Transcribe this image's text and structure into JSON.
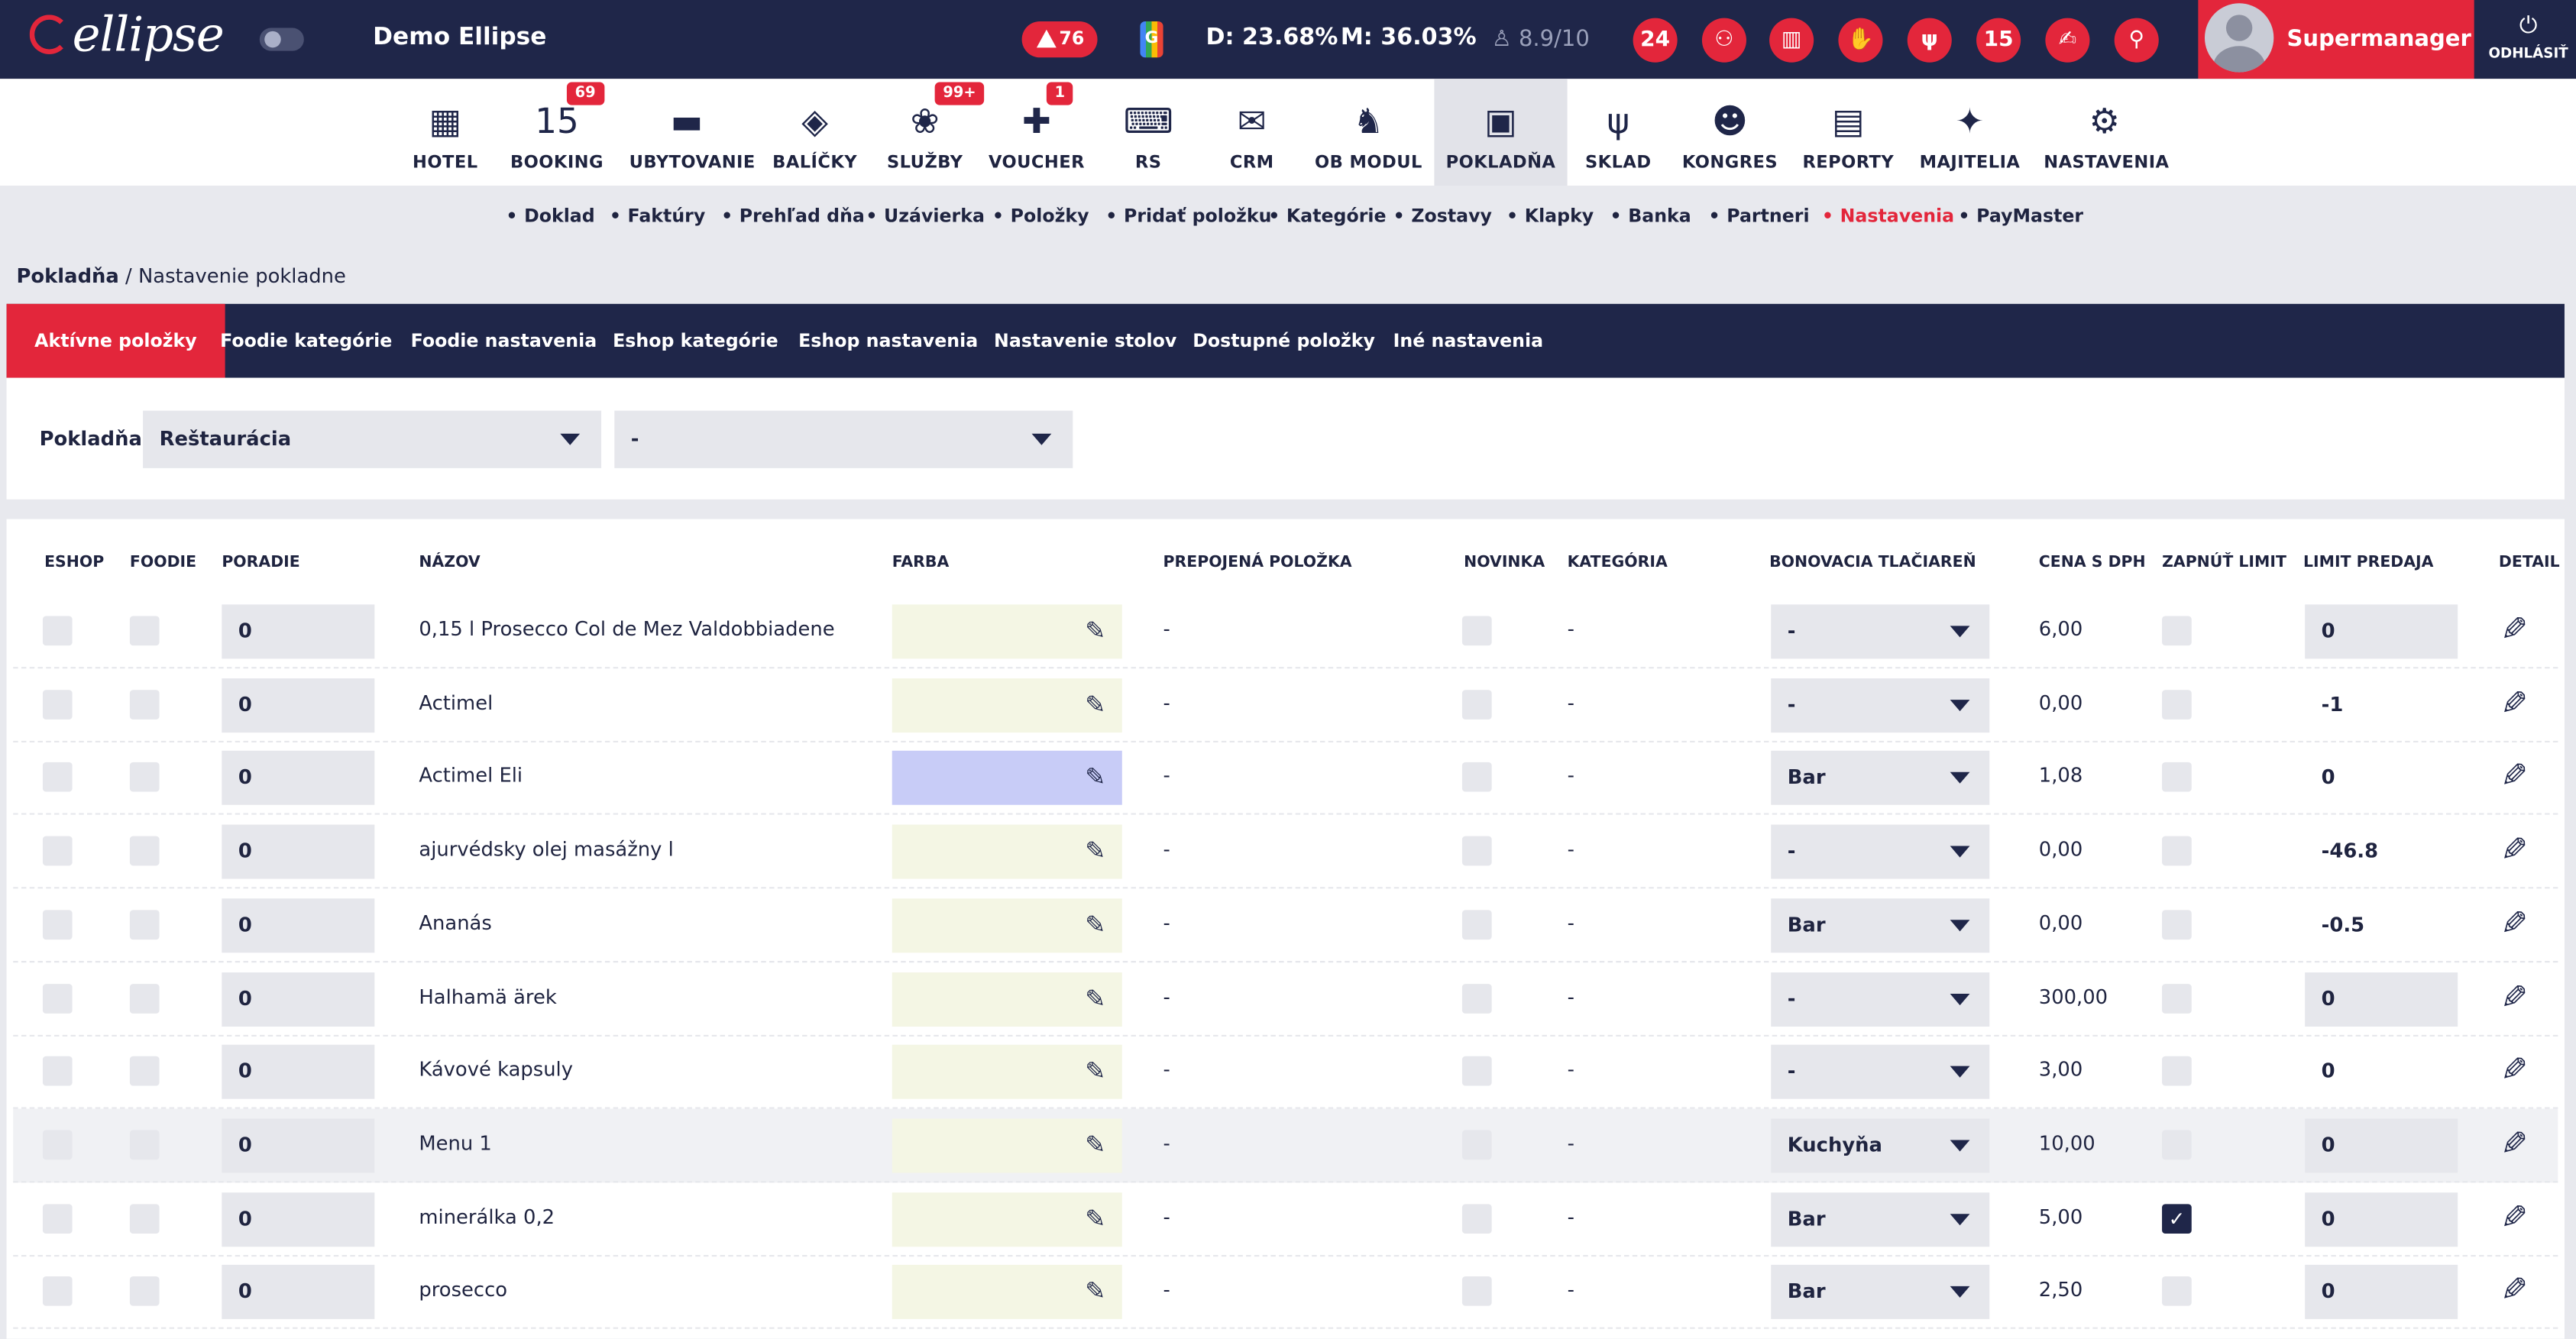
{
  "topbar": {
    "logo": "ellipse",
    "hotel_name": "Demo Ellipse",
    "alerts": "76",
    "g_label": "G",
    "occupancy_d": "D: 23.68%",
    "occupancy_m": "M: 36.03%",
    "rating": "8.9/10",
    "user_name": "Supermanager",
    "logout": "ODHLÁSIŤ",
    "logout_icon": "⏻",
    "round_icons": [
      {
        "name": "clock-24-icon",
        "glyph": "24"
      },
      {
        "name": "binoculars-icon",
        "glyph": "⚇"
      },
      {
        "name": "bar-chart-icon",
        "glyph": "▥"
      },
      {
        "name": "hand-coins-icon",
        "glyph": "✋"
      },
      {
        "name": "fork-knife-icon",
        "glyph": "ψ"
      },
      {
        "name": "calendar-icon",
        "glyph": "15"
      },
      {
        "name": "bell-hand-icon",
        "glyph": "✍"
      },
      {
        "name": "search-icon",
        "glyph": "⚲"
      }
    ]
  },
  "mainnav": [
    {
      "name": "hotel",
      "label": "HOTEL",
      "glyph": "▦"
    },
    {
      "name": "booking",
      "label": "BOOKING",
      "glyph": "15",
      "badge": "69"
    },
    {
      "name": "ubytovanie",
      "label": "UBYTOVANIE",
      "glyph": "▬"
    },
    {
      "name": "balicky",
      "label": "BALÍČKY",
      "glyph": "◈"
    },
    {
      "name": "sluzby",
      "label": "SLUŽBY",
      "glyph": "❀",
      "badge": "99+"
    },
    {
      "name": "voucher",
      "label": "VOUCHER",
      "glyph": "✚",
      "badge": "1"
    },
    {
      "name": "rs",
      "label": "RS",
      "glyph": "⌨"
    },
    {
      "name": "crm",
      "label": "CRM",
      "glyph": "✉"
    },
    {
      "name": "ob-modul",
      "label": "OB MODUL",
      "glyph": "♞"
    },
    {
      "name": "pokladna",
      "label": "POKLADŇA",
      "glyph": "▣"
    },
    {
      "name": "sklad",
      "label": "SKLAD",
      "glyph": "ψ"
    },
    {
      "name": "kongres",
      "label": "KONGRES",
      "glyph": "☻"
    },
    {
      "name": "reporty",
      "label": "REPORTY",
      "glyph": "▤"
    },
    {
      "name": "majitelia",
      "label": "MAJITELIA",
      "glyph": "✦"
    },
    {
      "name": "nastavenia",
      "label": "NASTAVENIA",
      "glyph": "⚙"
    }
  ],
  "subnav": [
    "Doklad",
    "Faktúry",
    "Prehľad dňa",
    "Uzávierka",
    "Položky",
    "Pridať položku",
    "Kategórie",
    "Zostavy",
    "Klapky",
    "Banka",
    "Partneri",
    "Nastavenia",
    "PayMaster"
  ],
  "breadcrumb": {
    "root": "Pokladňa",
    "current": " / Nastavenie pokladne"
  },
  "tabs": [
    "Aktívne položky",
    "Foodie kategórie",
    "Foodie nastavenia",
    "Eshop kategórie",
    "Eshop nastavenia",
    "Nastavenie stolov",
    "Dostupné položky",
    "Iné nastavenia"
  ],
  "filter": {
    "label": "Pokladňa:",
    "register": "Reštaurácia",
    "second": "-"
  },
  "table": {
    "headers": [
      "ESHOP",
      "FOODIE",
      "PORADIE",
      "NÁZOV",
      "FARBA",
      "PREPOJENÁ POLOŽKA",
      "NOVINKA",
      "KATEGÓRIA",
      "BONOVACIA TLAČIAREŇ",
      "CENA S DPH",
      "ZAPNÚŤ LIMIT",
      "LIMIT PREDAJA",
      "DETAIL"
    ],
    "rows": [
      {
        "order": "0",
        "name": "0,15 l Prosecco Col de Mez Valdobbiadene",
        "color": "#f4f6e4",
        "linked": "-",
        "category": "-",
        "printer": "-",
        "price": "6,00",
        "limit_on": false,
        "limit": "0",
        "limit_box": true,
        "highlight": false
      },
      {
        "order": "0",
        "name": "Actimel",
        "color": "#f4f6e4",
        "linked": "-",
        "category": "-",
        "printer": "-",
        "price": "0,00",
        "limit_on": false,
        "limit": "-1",
        "limit_box": false,
        "highlight": false
      },
      {
        "order": "0",
        "name": "Actimel Eli",
        "color": "#c8ccf7",
        "linked": "-",
        "category": "-",
        "printer": "Bar",
        "price": "1,08",
        "limit_on": false,
        "limit": "0",
        "limit_box": false,
        "highlight": false
      },
      {
        "order": "0",
        "name": "ajurvédsky olej masážny l",
        "color": "#f4f6e4",
        "linked": "-",
        "category": "-",
        "printer": "-",
        "price": "0,00",
        "limit_on": false,
        "limit": "-46.8",
        "limit_box": false,
        "highlight": false
      },
      {
        "order": "0",
        "name": "Ananás",
        "color": "#f4f6e4",
        "linked": "-",
        "category": "-",
        "printer": "Bar",
        "price": "0,00",
        "limit_on": false,
        "limit": "-0.5",
        "limit_box": false,
        "highlight": false
      },
      {
        "order": "0",
        "name": "Halhamä ärek",
        "color": "#f4f6e4",
        "linked": "-",
        "category": "-",
        "printer": "-",
        "price": "300,00",
        "limit_on": false,
        "limit": "0",
        "limit_box": true,
        "highlight": false
      },
      {
        "order": "0",
        "name": "Kávové kapsuly",
        "color": "#f4f6e4",
        "linked": "-",
        "category": "-",
        "printer": "-",
        "price": "3,00",
        "limit_on": false,
        "limit": "0",
        "limit_box": false,
        "highlight": false
      },
      {
        "order": "0",
        "name": "Menu 1",
        "color": "#f4f6e4",
        "linked": "-",
        "category": "-",
        "printer": "Kuchyňa",
        "price": "10,00",
        "limit_on": false,
        "limit": "0",
        "limit_box": true,
        "highlight": true
      },
      {
        "order": "0",
        "name": "minerálka 0,2",
        "color": "#f4f6e4",
        "linked": "-",
        "category": "-",
        "printer": "Bar",
        "price": "5,00",
        "limit_on": true,
        "limit": "0",
        "limit_box": true,
        "highlight": false
      },
      {
        "order": "0",
        "name": "prosecco",
        "color": "#f4f6e4",
        "linked": "-",
        "category": "-",
        "printer": "Bar",
        "price": "2,50",
        "limit_on": false,
        "limit": "0",
        "limit_box": true,
        "highlight": false
      }
    ]
  },
  "colors": {
    "navy": "#1f2649",
    "accent": "#e3263b",
    "input": "#e6e7ec"
  }
}
